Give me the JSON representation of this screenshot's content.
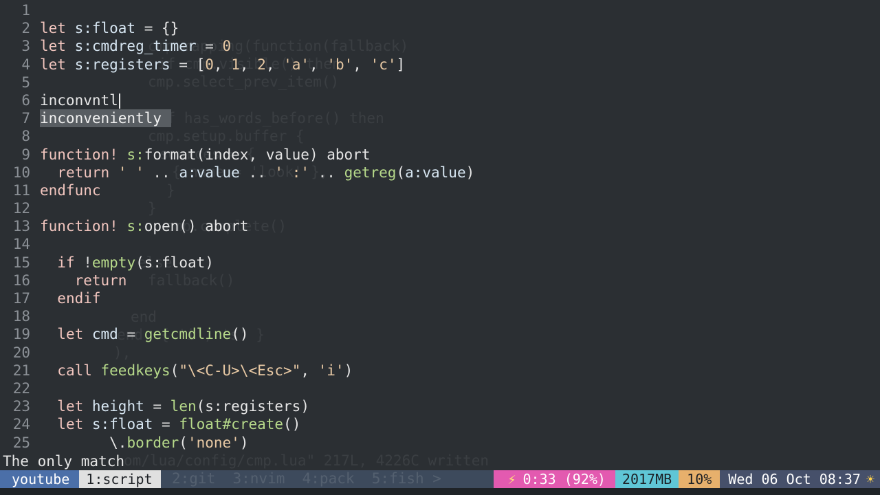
{
  "editor": {
    "lines": [
      {
        "n": "1",
        "tokens": []
      },
      {
        "n": "2",
        "tokens": [
          [
            "kw",
            "let "
          ],
          [
            "var",
            "s:float"
          ],
          [
            "op",
            " = "
          ],
          [
            "plain",
            "{}"
          ]
        ]
      },
      {
        "n": "3",
        "tokens": [
          [
            "kw",
            "let "
          ],
          [
            "var",
            "s:cmdreg_timer"
          ],
          [
            "op",
            " = "
          ],
          [
            "num",
            "0"
          ]
        ]
      },
      {
        "n": "4",
        "tokens": [
          [
            "kw",
            "let "
          ],
          [
            "var",
            "s:registers"
          ],
          [
            "op",
            " = "
          ],
          [
            "plain",
            "["
          ],
          [
            "num",
            "0"
          ],
          [
            "plain",
            ", "
          ],
          [
            "num",
            "1"
          ],
          [
            "plain",
            ", "
          ],
          [
            "num",
            "2"
          ],
          [
            "plain",
            ", "
          ],
          [
            "str",
            "'a'"
          ],
          [
            "plain",
            ", "
          ],
          [
            "str",
            "'b'"
          ],
          [
            "plain",
            ", "
          ],
          [
            "str",
            "'c'"
          ],
          [
            "plain",
            "]"
          ]
        ]
      },
      {
        "n": "5",
        "tokens": []
      },
      {
        "n": "6",
        "tokens": [
          [
            "plain",
            "inconvntl"
          ]
        ],
        "cursor": true
      },
      {
        "n": "7",
        "tokens": [],
        "popup": "inconveniently"
      },
      {
        "n": "8",
        "tokens": []
      },
      {
        "n": "9",
        "tokens": [
          [
            "kw",
            "function! "
          ],
          [
            "fn",
            "s:"
          ],
          [
            "plain",
            "format(index, value) "
          ],
          [
            "plain",
            "abort"
          ]
        ]
      },
      {
        "n": "10",
        "tokens": [
          [
            "plain",
            "  "
          ],
          [
            "kw",
            "return "
          ],
          [
            "str",
            "' '"
          ],
          [
            "op",
            " .. "
          ],
          [
            "var",
            "a:value"
          ],
          [
            "op",
            " .. "
          ],
          [
            "str",
            "' :'"
          ],
          [
            "op",
            " .. "
          ],
          [
            "fn",
            "getreg"
          ],
          [
            "plain",
            "("
          ],
          [
            "var",
            "a:value"
          ],
          [
            "plain",
            ")"
          ]
        ]
      },
      {
        "n": "11",
        "tokens": [
          [
            "kw",
            "endfunc"
          ]
        ]
      },
      {
        "n": "12",
        "tokens": []
      },
      {
        "n": "13",
        "tokens": [
          [
            "kw",
            "function! "
          ],
          [
            "fn",
            "s:"
          ],
          [
            "plain",
            "open() abort"
          ]
        ]
      },
      {
        "n": "14",
        "tokens": []
      },
      {
        "n": "15",
        "tokens": [
          [
            "plain",
            "  "
          ],
          [
            "kw",
            "if "
          ],
          [
            "op",
            "!"
          ],
          [
            "fn",
            "empty"
          ],
          [
            "plain",
            "(s:float)"
          ]
        ]
      },
      {
        "n": "16",
        "tokens": [
          [
            "plain",
            "    "
          ],
          [
            "kw",
            "return"
          ]
        ]
      },
      {
        "n": "17",
        "tokens": [
          [
            "plain",
            "  "
          ],
          [
            "kw",
            "endif"
          ]
        ]
      },
      {
        "n": "18",
        "tokens": []
      },
      {
        "n": "19",
        "tokens": [
          [
            "plain",
            "  "
          ],
          [
            "kw",
            "let "
          ],
          [
            "var",
            "cmd"
          ],
          [
            "op",
            " = "
          ],
          [
            "fn",
            "getcmdline"
          ],
          [
            "plain",
            "()"
          ]
        ]
      },
      {
        "n": "20",
        "tokens": []
      },
      {
        "n": "21",
        "tokens": [
          [
            "plain",
            "  "
          ],
          [
            "kw",
            "call "
          ],
          [
            "fn",
            "feedkeys"
          ],
          [
            "plain",
            "("
          ],
          [
            "str",
            "\"\\<C-U>\\<Esc>\""
          ],
          [
            "plain",
            ", "
          ],
          [
            "str",
            "'i'"
          ],
          [
            "plain",
            ")"
          ]
        ]
      },
      {
        "n": "22",
        "tokens": []
      },
      {
        "n": "23",
        "tokens": [
          [
            "plain",
            "  "
          ],
          [
            "kw",
            "let "
          ],
          [
            "var",
            "height"
          ],
          [
            "op",
            " = "
          ],
          [
            "fn",
            "len"
          ],
          [
            "plain",
            "(s:registers)"
          ]
        ]
      },
      {
        "n": "24",
        "tokens": [
          [
            "plain",
            "  "
          ],
          [
            "kw",
            "let "
          ],
          [
            "var",
            "s:float"
          ],
          [
            "op",
            " = "
          ],
          [
            "fn",
            "float#create"
          ],
          [
            "plain",
            "()"
          ]
        ]
      },
      {
        "n": "25",
        "tokens": [
          [
            "plain",
            "        \\."
          ],
          [
            "fn",
            "border"
          ],
          [
            "plain",
            "("
          ],
          [
            "str",
            "'none'"
          ],
          [
            "plain",
            ")"
          ]
        ]
      }
    ]
  },
  "ghost_text": [
    "cmp.mapping(function(fallback)",
    "if cmp.visible() then",
    "cmp.select_prev_item()",
    "if has_words_before() then",
    "cmp.setup.buffer {",
    "sources = {",
    "{ name = 'look' },",
    "}",
    "}",
    "cmp.complete()",
    "else",
    "fallback()",
    "end",
    "end, { 'i', 's' }",
    "),",
    "om/lua/config/cmp.lua\" 217L, 4226C written",
    "2:git  3:nvim  4:pack  5:fish >"
  ],
  "cmdline": {
    "message": "The only match"
  },
  "statusbar": {
    "session": "youtube",
    "window": "1:script",
    "battery_icon": "bolt-icon",
    "battery": "0:33 (92%)",
    "memory": "2017MB",
    "cpu": "10%",
    "datetime": "Wed 06 Oct 08:37",
    "weather_icon": "sun-icon",
    "colors": {
      "session_bg": "#4b6fa8",
      "window_bg": "#e0e0e0",
      "battery_bg": "#e35ab0",
      "memory_bg": "#5fc6d6",
      "cpu_bg": "#e7b06c",
      "clock_bg": "#46506a"
    }
  }
}
